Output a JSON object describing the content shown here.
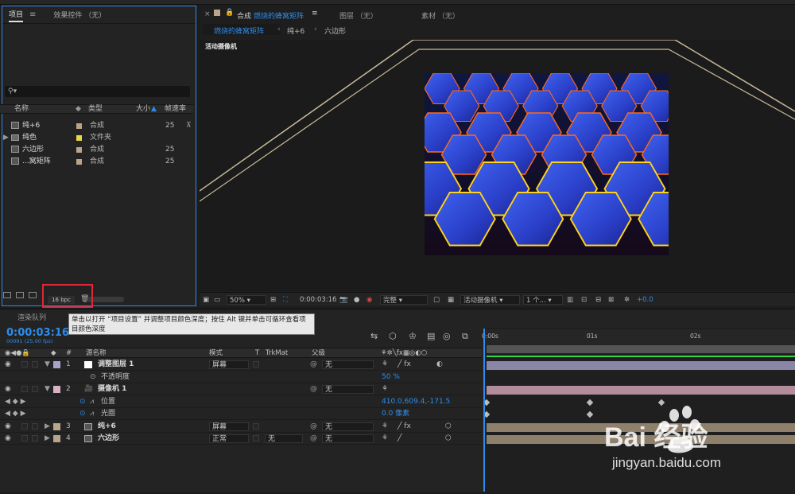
{
  "project_panel": {
    "tab_project": "项目",
    "tab_effects": "效果控件 （无）",
    "search_placeholder": "",
    "columns": {
      "name": "名称",
      "type": "类型",
      "size": "大小",
      "fps": "帧速率"
    },
    "items": [
      {
        "name": "纯+6",
        "type": "合成",
        "fps": "25",
        "color": "#b8a58a"
      },
      {
        "name": "纯色",
        "type": "文件夹",
        "fps": "",
        "color": "#e6d84c"
      },
      {
        "name": "六边形",
        "type": "合成",
        "fps": "25",
        "color": "#b8a58a"
      },
      {
        "name": "...窝矩阵",
        "type": "合成",
        "fps": "25",
        "color": "#b8a58a"
      }
    ],
    "bpc": "16 bpc"
  },
  "viewer": {
    "tab_comp_prefix": "合成",
    "tab_comp_name": "燃烧的蜂窝矩阵",
    "tab_layer": "图层 （无）",
    "tab_footage": "素材 （无）",
    "breadcrumb": [
      "燃烧的蜂窝矩阵",
      "纯+6",
      "六边形"
    ],
    "camera_label": "活动摄像机",
    "zoom": "50%",
    "timecode": "0:00:03:16",
    "resolution": "完整",
    "camera_select": "活动摄像机",
    "views": "1 个...",
    "exposure": "+0.0"
  },
  "timeline": {
    "render_tab": "渲染队列",
    "timecode": "0:00:03:16",
    "fps_sub": "00091 (25.00 fps)",
    "tooltip": "单击以打开 “项目设置” 并调整项目颜色深度；按住 Alt 键并单击可循环查看项目颜色深度",
    "columns": {
      "num": "#",
      "source": "源名称",
      "mode": "模式",
      "t": "T",
      "trkmat": "TrkMat",
      "parent": "父级"
    },
    "ruler": [
      "0:00s",
      "01s",
      "02s"
    ],
    "layers": [
      {
        "num": "1",
        "name": "调整图层 1",
        "mode": "屏幕",
        "trkmat": "",
        "parent": "无",
        "color": "#a9a2cc",
        "bar": "#8a86a8"
      },
      {
        "prop": "不透明度",
        "value": "50 %"
      },
      {
        "num": "2",
        "name": "摄像机 1",
        "mode": "",
        "trkmat": "",
        "parent": "无",
        "color": "#d8b2c4",
        "bar": "#b38c9b"
      },
      {
        "prop": "位置",
        "value": "410.0,609.4,-171.5"
      },
      {
        "prop": "光圈",
        "value": "0.0 像素"
      },
      {
        "num": "3",
        "name": "纯+6",
        "mode": "屏幕",
        "trkmat": "",
        "parent": "无",
        "color": "#b8a58a",
        "bar": "#8e806b"
      },
      {
        "num": "4",
        "name": "六边形",
        "mode": "正常",
        "trkmat": "无",
        "parent": "无",
        "color": "#b8a58a",
        "bar": "#8e806b"
      }
    ]
  },
  "watermark": {
    "brand": "Bai 经验",
    "url": "jingyan.baidu.com"
  }
}
